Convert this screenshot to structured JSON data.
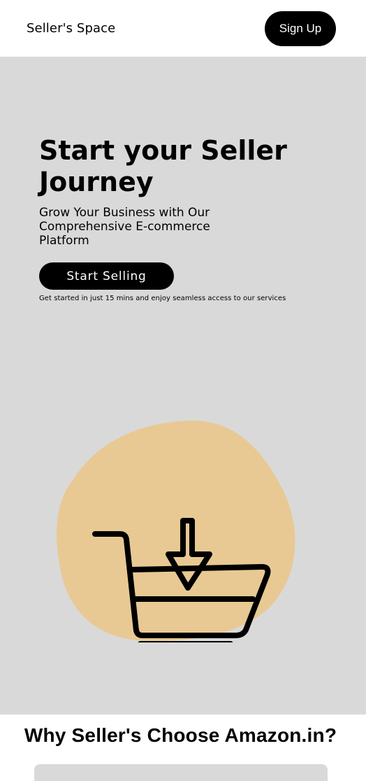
{
  "navbar": {
    "brand": "Seller's Space",
    "signup_label": "Sign Up"
  },
  "hero": {
    "title": "Start your Seller Journey",
    "subtitle": "Grow Your Business with Our Comprehensive E-commerce Platform",
    "cta_label": "Start Selling",
    "note": "Get started in just 15 mins and enjoy seamless access to our services",
    "illustration_icon": "shopping-cart-download-icon",
    "blob_color": "#e8c994",
    "background_color": "#d9d9d9"
  },
  "why": {
    "title": "Why Seller's Choose Amazon.in?"
  }
}
